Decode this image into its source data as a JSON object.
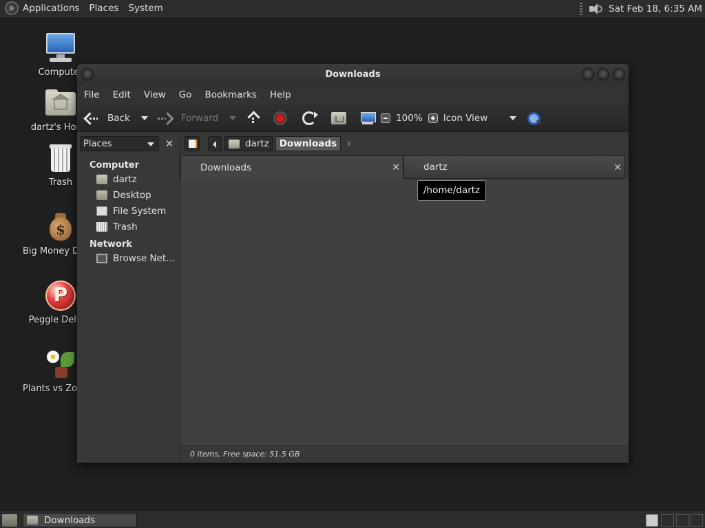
{
  "top_panel": {
    "menus": [
      "Applications",
      "Places",
      "System"
    ],
    "clock": "Sat Feb 18,  6:35 AM"
  },
  "desktop": {
    "icons": [
      {
        "label": "Computer",
        "icon": "computer-icon"
      },
      {
        "label": "dartz's Home",
        "icon": "home-folder-icon"
      },
      {
        "label": "Trash",
        "icon": "trash-icon"
      },
      {
        "label": "Big Money Deluxe",
        "icon": "money-bag-icon"
      },
      {
        "label": "Peggle Deluxe",
        "icon": "peggle-icon"
      },
      {
        "label": "Plants vs Zombies",
        "icon": "plants-icon"
      }
    ]
  },
  "window": {
    "title": "Downloads",
    "menubar": [
      "File",
      "Edit",
      "View",
      "Go",
      "Bookmarks",
      "Help"
    ],
    "toolbar": {
      "back": "Back",
      "forward": "Forward",
      "zoom": "100%",
      "view_mode": "Icon View"
    },
    "sidebar": {
      "selector": "Places",
      "sections": [
        {
          "title": "Computer",
          "items": [
            "dartz",
            "Desktop",
            "File System",
            "Trash"
          ]
        },
        {
          "title": "Network",
          "items": [
            "Browse Net…"
          ]
        }
      ]
    },
    "pathbar": {
      "crumbs": [
        "dartz",
        "Downloads"
      ]
    },
    "tabs": [
      {
        "label": "Downloads"
      },
      {
        "label": "dartz"
      }
    ],
    "tooltip": "/home/dartz",
    "status": "0 items, Free space: 51.5 GB"
  },
  "bottom_panel": {
    "task": "Downloads"
  }
}
